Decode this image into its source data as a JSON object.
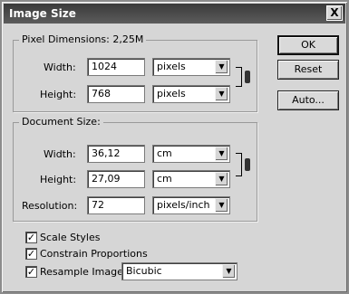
{
  "window": {
    "title": "Image Size",
    "close_label": "X"
  },
  "pixel_dimensions": {
    "legend": "Pixel Dimensions: 2,25M",
    "width": {
      "label": "Width:",
      "value": "1024",
      "unit": "pixels"
    },
    "height": {
      "label": "Height:",
      "value": "768",
      "unit": "pixels"
    }
  },
  "document_size": {
    "legend": "Document Size:",
    "width": {
      "label": "Width:",
      "value": "36,12",
      "unit": "cm"
    },
    "height": {
      "label": "Height:",
      "value": "27,09",
      "unit": "cm"
    },
    "resolution": {
      "label": "Resolution:",
      "value": "72",
      "unit": "pixels/inch"
    }
  },
  "buttons": {
    "ok": "OK",
    "reset": "Reset",
    "auto": "Auto..."
  },
  "options": {
    "scale_styles": {
      "label": "Scale Styles",
      "checked": true
    },
    "constrain_proportions": {
      "label": "Constrain Proportions",
      "checked": true
    },
    "resample_image": {
      "label": "Resample Image:",
      "checked": true,
      "method": "Bicubic"
    }
  },
  "check_mark": "✓",
  "arrow_glyph": "▼"
}
